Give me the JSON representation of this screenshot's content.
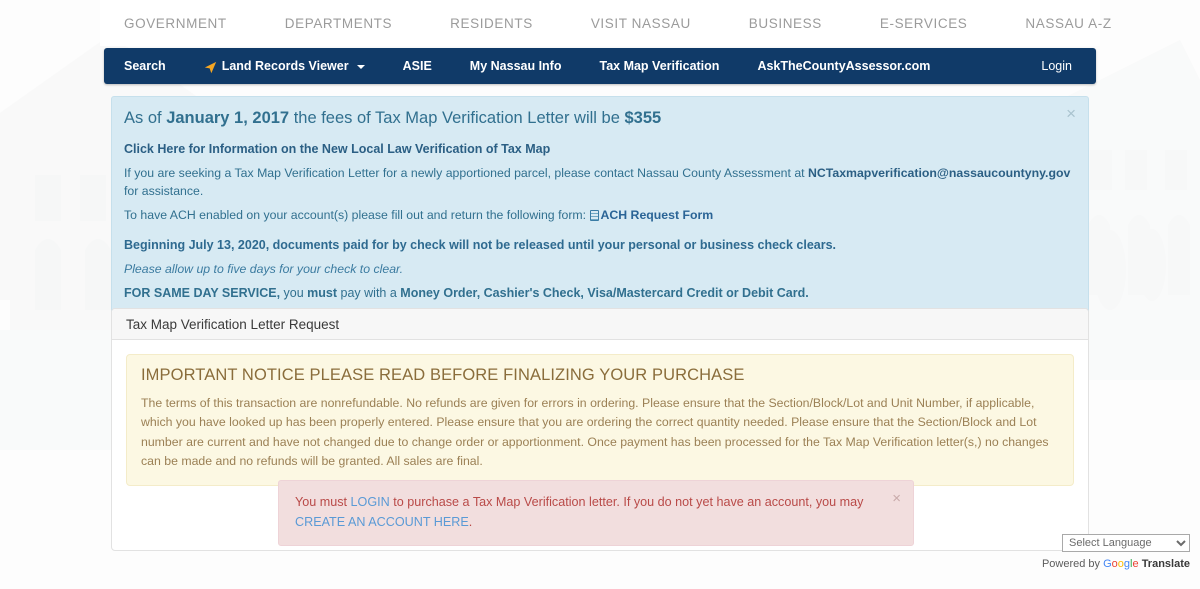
{
  "top_nav": {
    "items": [
      {
        "label": "GOVERNMENT",
        "name": "government"
      },
      {
        "label": "DEPARTMENTS",
        "name": "departments"
      },
      {
        "label": "RESIDENTS",
        "name": "residents"
      },
      {
        "label": "VISIT NASSAU",
        "name": "visit-nassau"
      },
      {
        "label": "BUSINESS",
        "name": "business"
      },
      {
        "label": "E-SERVICES",
        "name": "e-services"
      },
      {
        "label": "NASSAU A-Z",
        "name": "nassau-a-z"
      }
    ]
  },
  "blue_nav": {
    "background_color": "#103a68",
    "items": [
      {
        "label": "Search"
      },
      {
        "label": "Land Records Viewer"
      },
      {
        "label": "ASIE"
      },
      {
        "label": "My Nassau Info"
      },
      {
        "label": "Tax Map Verification"
      },
      {
        "label": "AskTheCountyAssessor.com"
      }
    ],
    "login_label": "Login",
    "arrow_icon_color": "#f5a623"
  },
  "info_alert": {
    "heading_prefix": "As of ",
    "heading_date": "January 1, 2017",
    "heading_mid": " the fees of Tax Map Verification Letter will be ",
    "heading_fee": "$355",
    "local_law_link": "Click Here for Information on the New Local Law Verification of Tax Map",
    "apportion_prefix": "If you are seeking a Tax Map Verification Letter for a newly apportioned parcel, please contact Nassau County Assessment at ",
    "apportion_email": "NCTaxmapverification@nassaucountyny.gov",
    "apportion_suffix": " for assistance.",
    "ach_prefix": "To have ACH enabled on your account(s) please fill out and return the following form: ",
    "ach_link": "ACH Request Form",
    "check_notice": "Beginning July 13, 2020, documents paid for by check will not be released until your personal or business check clears.",
    "check_italic": "Please allow up to five days for your check to clear.",
    "same_day_bold": "FOR SAME DAY SERVICE,",
    "same_day_mid": " you ",
    "same_day_must": "must",
    "same_day_mid2": " pay with a ",
    "same_day_methods": "Money Order, Cashier's Check, Visa/Mastercard Credit or Debit Card.",
    "close_label": "×",
    "background_color": "#d7eaf3",
    "text_color": "#31708f"
  },
  "panel": {
    "title": "Tax Map Verification Letter Request"
  },
  "warning_notice": {
    "title": "IMPORTANT NOTICE PLEASE READ BEFORE FINALIZING YOUR PURCHASE",
    "body": "The terms of this transaction are nonrefundable. No refunds are given for errors in ordering. Please ensure that the Section/Block/Lot and Unit Number, if applicable, which you have looked up has been properly entered. Please ensure that you are ordering the correct quantity needed. Please ensure that the Section/Block and Lot number are current and have not changed due to change order or apportionment. Once payment has been processed for the Tax Map Verification letter(s,) no changes can be made and no refunds will be granted. All sales are final.",
    "background_color": "#fcf8e3",
    "text_color": "#8a6d3b"
  },
  "danger_alert": {
    "prefix": "You must ",
    "login_link": "LOGIN",
    "middle": " to purchase a Tax Map Verification letter. If you do not yet have an account, you may ",
    "create_link": "CREATE AN ACCOUNT HERE",
    "suffix": ".",
    "close_label": "×",
    "background_color": "#f2dede",
    "text_color": "#b94a48"
  },
  "translate": {
    "selected": "Select Language",
    "options": [
      "Select Language"
    ],
    "powered_by": "Powered by",
    "google_letters": [
      "G",
      "o",
      "o",
      "g",
      "l",
      "e"
    ],
    "translate_word": "Translate"
  }
}
